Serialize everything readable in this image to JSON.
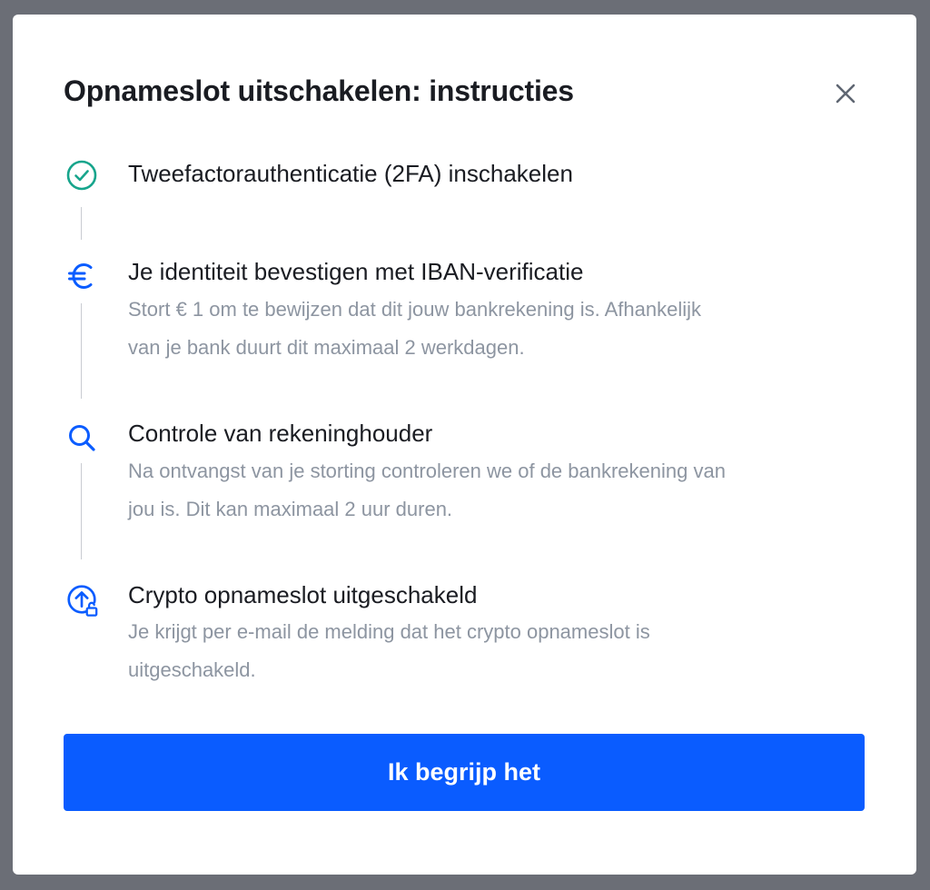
{
  "modal": {
    "title": "Opnameslot uitschakelen: instructies",
    "close_icon": "close-icon",
    "steps": [
      {
        "icon": "check-circle-icon",
        "status": "completed",
        "title": "Tweefactorauthenticatie (2FA) inschakelen",
        "description": ""
      },
      {
        "icon": "euro-icon",
        "title": "Je identiteit bevestigen met IBAN-verificatie",
        "description_line1": "Stort € 1 om te bewijzen dat dit jouw bankrekening is. Afhankelijk",
        "description_line2": "van je bank duurt dit maximaal 2 werkdagen."
      },
      {
        "icon": "search-icon",
        "title": "Controle van rekeninghouder",
        "description_line1": "Na ontvangst van je storting controleren we of de bankrekening van",
        "description_line2": "jou is. Dit kan maximaal 2 uur duren."
      },
      {
        "icon": "upload-unlock-icon",
        "title": "Crypto opnameslot uitgeschakeld",
        "description_line1": "Je krijgt per e-mail de melding dat het crypto opnameslot is",
        "description_line2": "uitgeschakeld."
      }
    ],
    "confirm_label": "Ik begrijp het"
  },
  "colors": {
    "overlay": "#6b6e76",
    "accent": "#0a5cff",
    "success": "#17a58c",
    "text_primary": "#1a1c22",
    "text_secondary": "#8d95a1",
    "connector": "#c9ccd2"
  }
}
